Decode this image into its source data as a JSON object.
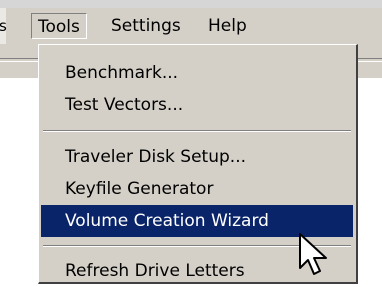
{
  "menubar": {
    "edge_char": "s",
    "titles": [
      "Tools",
      "Settings",
      "Help"
    ],
    "active": "Tools"
  },
  "tools_menu": {
    "items": [
      {
        "label": "Benchmark..."
      },
      {
        "label": "Test Vectors..."
      },
      {
        "label": "Traveler Disk Setup..."
      },
      {
        "label": "Keyfile Generator"
      },
      {
        "label": "Volume Creation Wizard",
        "selected": true
      },
      {
        "label": "Refresh Drive Letters"
      }
    ]
  },
  "colors": {
    "menu_bg": "#d4d0c8",
    "highlight_bg": "#0a246a",
    "highlight_text": "#ffffff"
  },
  "icons": {
    "cursor": "arrow-pointer-icon"
  }
}
